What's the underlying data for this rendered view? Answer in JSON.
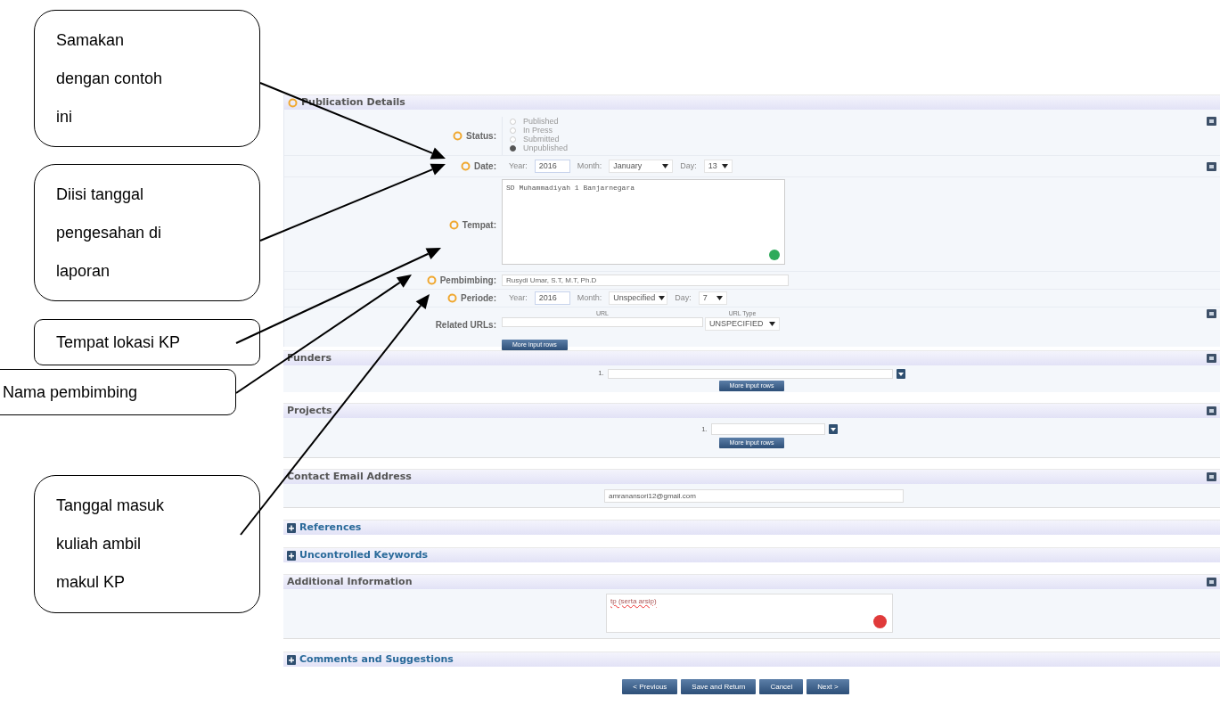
{
  "annotations": [
    {
      "text": "Samakan dengan contoh ini",
      "kind": "status"
    },
    {
      "text": "Diisi tanggal pengesahan di laporan",
      "kind": "date"
    },
    {
      "text": "Tempat lokasi KP",
      "kind": "tempat"
    },
    {
      "text": "Nama pembimbing",
      "kind": "pembimbing"
    },
    {
      "text": "Tanggal masuk kuliah ambil makul KP",
      "kind": "periode"
    }
  ],
  "publication_details": {
    "title": "Publication Details",
    "status": {
      "label": "Status:",
      "options": [
        {
          "label": "Published",
          "selected": false
        },
        {
          "label": "In Press",
          "selected": false
        },
        {
          "label": "Submitted",
          "selected": false
        },
        {
          "label": "Unpublished",
          "selected": true
        }
      ]
    },
    "date": {
      "label": "Date:",
      "year_label": "Year:",
      "year": "2016",
      "month_label": "Month:",
      "month": "January",
      "day_label": "Day:",
      "day": "13"
    },
    "tempat": {
      "label": "Tempat:",
      "value": "SD Muhammadiyah 1 Banjarnegara"
    },
    "pembimbing": {
      "label": "Pembimbing:",
      "value": "Rusydi Umar, S.T, M.T, Ph.D"
    },
    "periode": {
      "label": "Periode:",
      "year_label": "Year:",
      "year": "2016",
      "month_label": "Month:",
      "month": "Unspecified",
      "day_label": "Day:",
      "day": "7"
    },
    "related_urls": {
      "label": "Related URLs:",
      "url_header": "URL",
      "type_header": "URL Type",
      "type_value": "UNSPECIFIED",
      "button": "More input rows"
    }
  },
  "funders": {
    "title": "Funders",
    "row_number": "1.",
    "button": "More input rows"
  },
  "projects": {
    "title": "Projects",
    "row_number": "1.",
    "button": "More input rows"
  },
  "contact_email": {
    "title": "Contact Email Address",
    "value": "amranansori12@gmail.com"
  },
  "collapsed_a": [
    {
      "title": "References",
      "expanded": false
    },
    {
      "title": "Uncontrolled Keywords",
      "expanded": false
    }
  ],
  "additional_information": {
    "title": "Additional Information",
    "value": "tp (serta arsip)"
  },
  "collapsed_b": [
    {
      "title": "Comments and Suggestions",
      "expanded": false
    }
  ],
  "buttons": [
    "< Previous",
    "Save and Return",
    "Cancel",
    "Next >"
  ]
}
